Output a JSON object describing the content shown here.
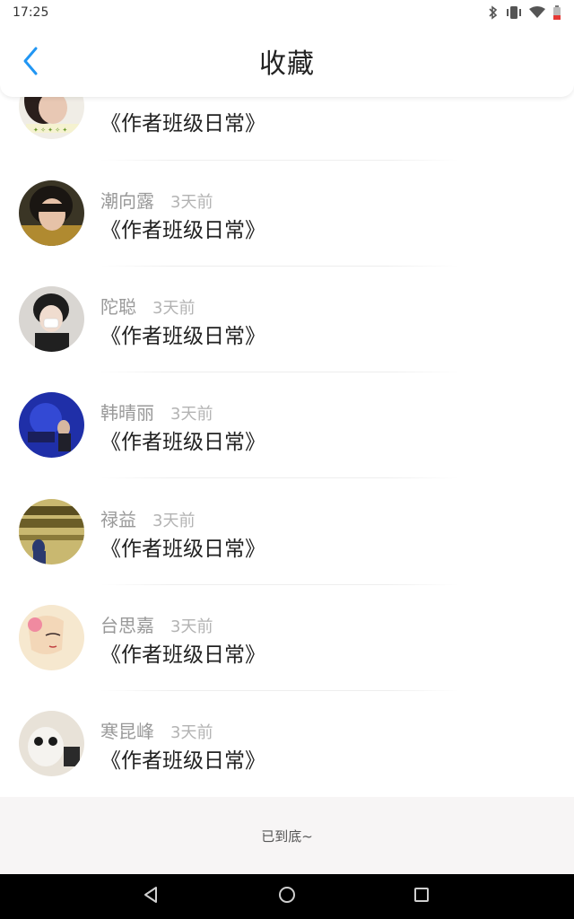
{
  "status_bar": {
    "time": "17:25"
  },
  "header": {
    "title": "收藏"
  },
  "colors": {
    "accent": "#2196f3",
    "author": "#999999",
    "time": "#b3b3b3"
  },
  "items": [
    {
      "author": "",
      "time": "",
      "title": "《作者班级日常》"
    },
    {
      "author": "潮向露",
      "time": "3天前",
      "title": "《作者班级日常》"
    },
    {
      "author": "陀聪",
      "time": "3天前",
      "title": "《作者班级日常》"
    },
    {
      "author": "韩晴丽",
      "time": "3天前",
      "title": "《作者班级日常》"
    },
    {
      "author": "禄益",
      "time": "3天前",
      "title": "《作者班级日常》"
    },
    {
      "author": "台思嘉",
      "time": "3天前",
      "title": "《作者班级日常》"
    },
    {
      "author": "寒昆峰",
      "time": "3天前",
      "title": "《作者班级日常》"
    }
  ],
  "footer": {
    "text": "已到底~"
  }
}
